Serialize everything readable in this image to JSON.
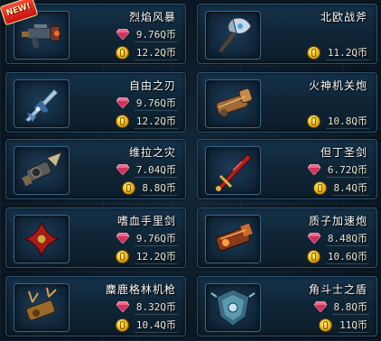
{
  "badge": {
    "new_label": "NEW!"
  },
  "currency": {
    "gem_icon": "gem-icon",
    "coin_icon": "coin-icon"
  },
  "items": [
    {
      "name": "烈焰风暴",
      "gem_price": "9.76Q币",
      "coin_price": "12.2Q币",
      "icon": "flame-launcher"
    },
    {
      "name": "北欧战斧",
      "gem_price": "",
      "coin_price": "11.2Q币",
      "icon": "battle-axe"
    },
    {
      "name": "自由之刃",
      "gem_price": "9.76Q币",
      "coin_price": "12.2Q币",
      "icon": "blade"
    },
    {
      "name": "火神机关炮",
      "gem_price": "",
      "coin_price": "10.8Q币",
      "icon": "gatling-gun"
    },
    {
      "name": "维拉之灾",
      "gem_price": "7.04Q币",
      "coin_price": "8.8Q币",
      "icon": "drill-cannon"
    },
    {
      "name": "但丁圣剑",
      "gem_price": "6.72Q币",
      "coin_price": "8.4Q币",
      "icon": "holy-sword"
    },
    {
      "name": "嗜血手里剑",
      "gem_price": "9.76Q币",
      "coin_price": "12.2Q币",
      "icon": "shuriken"
    },
    {
      "name": "质子加速炮",
      "gem_price": "8.48Q币",
      "coin_price": "10.6Q币",
      "icon": "proton-cannon"
    },
    {
      "name": "麋鹿格林机枪",
      "gem_price": "8.32Q币",
      "coin_price": "10.4Q币",
      "icon": "antler-gun"
    },
    {
      "name": "角斗士之盾",
      "gem_price": "8.8Q币",
      "coin_price": "11Q币",
      "icon": "gladiator-shield"
    }
  ]
}
